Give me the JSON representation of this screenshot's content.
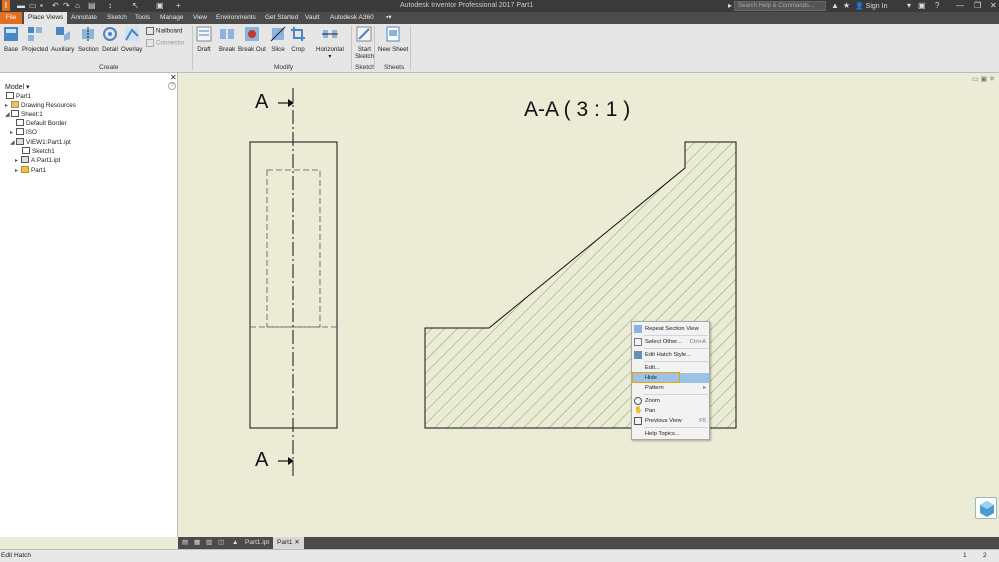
{
  "app": {
    "title": "Autodesk Inventor Professional 2017    Part1",
    "search_placeholder": "Search Help & Commands...",
    "sign_in": "Sign In"
  },
  "tabs": [
    "File",
    "Place Views",
    "Annotate",
    "Sketch",
    "Tools",
    "Manage",
    "View",
    "Environments",
    "Get Started",
    "Vault",
    "Autodesk A360"
  ],
  "active_tab": "Place Views",
  "ribbon": {
    "create": {
      "label": "Create",
      "buttons": [
        "Base",
        "Projected",
        "Auxiliary",
        "Section",
        "Detail",
        "Overlay"
      ],
      "small": [
        "Nailboard",
        "Connector"
      ]
    },
    "modify": {
      "label": "Modify",
      "buttons": [
        "Draft",
        "Break",
        "Break Out",
        "Slice",
        "Crop",
        "Horizontal"
      ]
    },
    "sketch": {
      "label": "Sketch",
      "button_line1": "Start",
      "button_line2": "Sketch"
    },
    "sheets": {
      "label": "Sheets",
      "button": "New Sheet"
    }
  },
  "browser": {
    "header": "Model",
    "nodes": [
      "Part1",
      "Drawing Resources",
      "Sheet:1",
      "Default Border",
      "ISO",
      "VIEW1:Part1.ipt",
      "Sketch1",
      "A:Part1.ipt",
      "Part1"
    ]
  },
  "drawing": {
    "section_label_top": "A",
    "section_label_bottom": "A",
    "view_title": "A-A ( 3 : 1 )"
  },
  "context_menu": {
    "items": [
      {
        "label": "Repeat Section View",
        "shortcut": ""
      },
      {
        "label": "Select Other...",
        "shortcut": "Ctrl+A"
      },
      {
        "label": "Edit Hatch Style...",
        "shortcut": ""
      },
      {
        "label": "Edit...",
        "shortcut": ""
      },
      {
        "label": "Hide",
        "shortcut": ""
      },
      {
        "label": "Pattern",
        "shortcut": ""
      },
      {
        "label": "Zoom",
        "shortcut": ""
      },
      {
        "label": "Pan",
        "shortcut": ""
      },
      {
        "label": "Previous View",
        "shortcut": "F5"
      },
      {
        "label": "Help Topics...",
        "shortcut": ""
      }
    ],
    "highlighted": "Hide"
  },
  "doc_tabs": [
    "Part1.ipt",
    "Part1"
  ],
  "active_doc": "Part1",
  "status": {
    "text": "Edit Hatch",
    "count1": "1",
    "count2": "2"
  },
  "colors": {
    "file_tab": "#e07020",
    "hatch": "#5a9a40",
    "canvas": "#ecebd6",
    "menu_highlight": "#9cc2e6",
    "highlight_border": "#e9a800"
  }
}
